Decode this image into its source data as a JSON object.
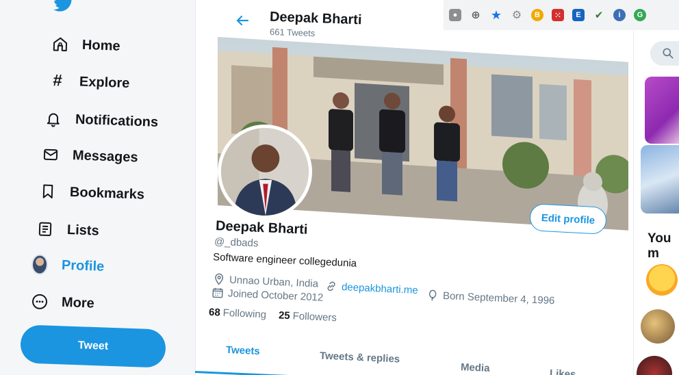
{
  "sidebar": {
    "items": [
      {
        "label": "Home",
        "icon": "home-icon"
      },
      {
        "label": "Explore",
        "icon": "hashtag-icon"
      },
      {
        "label": "Notifications",
        "icon": "bell-icon"
      },
      {
        "label": "Messages",
        "icon": "envelope-icon"
      },
      {
        "label": "Bookmarks",
        "icon": "bookmark-icon"
      },
      {
        "label": "Lists",
        "icon": "list-icon"
      },
      {
        "label": "Profile",
        "icon": "avatar"
      },
      {
        "label": "More",
        "icon": "more-icon"
      }
    ],
    "tweet_button": "Tweet"
  },
  "header": {
    "name": "Deepak Bharti",
    "tweet_count": "661 Tweets"
  },
  "profile": {
    "name": "Deepak Bharti",
    "handle": "@_dbads",
    "bio": "Software engineer collegedunia",
    "location": "Unnao Urban, India",
    "website": "deepakbharti.me",
    "born": "Born September 4, 1996",
    "joined": "Joined October 2012",
    "following_count": "68",
    "following_label": "Following",
    "followers_count": "25",
    "followers_label": "Followers",
    "edit_button": "Edit profile"
  },
  "tabs": [
    {
      "label": "Tweets"
    },
    {
      "label": "Tweets & replies"
    },
    {
      "label": "Media"
    },
    {
      "label": "Likes"
    }
  ],
  "right": {
    "you_may_like": "You m"
  },
  "colors": {
    "accent": "#1b95e0",
    "text": "#14171a",
    "muted": "#657786"
  }
}
